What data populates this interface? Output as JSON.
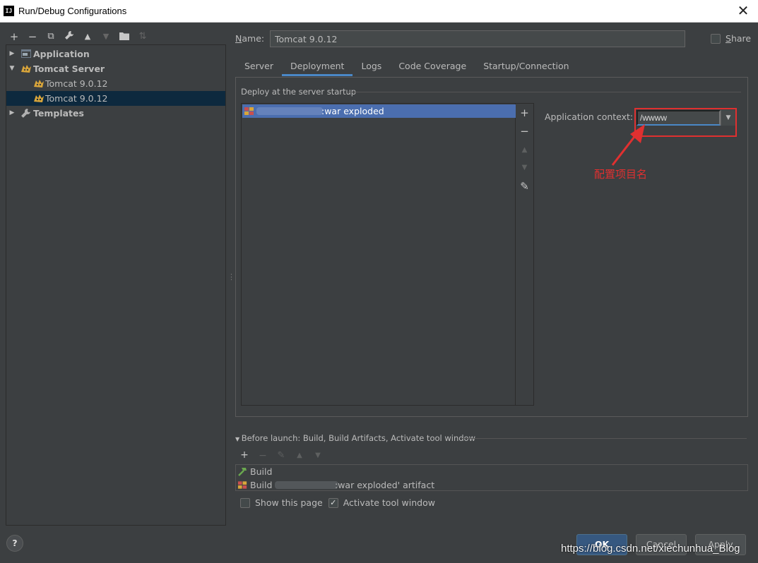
{
  "window": {
    "title": "Run/Debug Configurations",
    "app_icon": "IJ",
    "close_glyph": "✕"
  },
  "toolbar": {
    "items": [
      {
        "name": "add-icon",
        "glyph": "+"
      },
      {
        "name": "remove-icon",
        "glyph": "−"
      },
      {
        "name": "copy-icon",
        "glyph": "⧉"
      },
      {
        "name": "wrench-icon",
        "glyph": "🔧"
      },
      {
        "name": "move-up-icon",
        "glyph": "▲"
      },
      {
        "name": "move-down-icon",
        "glyph": "▼"
      },
      {
        "name": "folder-icon",
        "glyph": "▰"
      },
      {
        "name": "sort-icon",
        "glyph": "⇅"
      }
    ]
  },
  "tree": {
    "items": [
      {
        "label": "Application",
        "bold": true,
        "expanded": false,
        "icon": "application-icon"
      },
      {
        "label": "Tomcat Server",
        "bold": true,
        "expanded": true,
        "icon": "tomcat-icon"
      },
      {
        "label": "Tomcat 9.0.12",
        "bold": false,
        "icon": "tomcat-icon"
      },
      {
        "label": "Tomcat 9.0.12",
        "bold": false,
        "icon": "tomcat-icon",
        "selected": true
      },
      {
        "label": "Templates",
        "bold": true,
        "expanded": false,
        "icon": "wrench-icon"
      }
    ]
  },
  "help": "?",
  "name_field": {
    "label_prefix": "N",
    "label_rest": "ame:",
    "value": "Tomcat 9.0.12"
  },
  "share": {
    "label_prefix": "S",
    "label_rest": "hare",
    "checked": false
  },
  "tabs": [
    {
      "label": "Server",
      "active": false
    },
    {
      "label": "Deployment",
      "active": true
    },
    {
      "label": "Logs",
      "active": false
    },
    {
      "label": "Code Coverage",
      "active": false
    },
    {
      "label": "Startup/Connection",
      "active": false
    }
  ],
  "deployment": {
    "section_title": "Deploy at the server startup",
    "items": [
      {
        "text": ":war exploded",
        "selected": true
      }
    ],
    "side_tools": [
      "+",
      "−",
      "▲",
      "▼",
      "✎"
    ],
    "context_label": "Application context:",
    "context_value": "/wwww",
    "annotation": "配置项目名",
    "highlight_color": "#e03030"
  },
  "before_launch": {
    "title": "Before launch: Build, Build Artifacts, Activate tool window",
    "tools": [
      "+",
      "−",
      "✎",
      "▲",
      "▼"
    ],
    "items": [
      {
        "label": "Build",
        "icon": "hammer-icon"
      },
      {
        "label_prefix": "Build",
        "label_suffix": ":war exploded' artifact",
        "icon": "artifact-icon"
      }
    ]
  },
  "options": {
    "show_this_page": {
      "label": "Show this page",
      "checked": false
    },
    "activate_tool_window": {
      "label": "Activate tool window",
      "checked": true
    }
  },
  "buttons": {
    "ok": "OK",
    "cancel": "Cancel",
    "apply": "Apply"
  },
  "watermark": "https://blog.csdn.net/xiechunhua_Blog",
  "colors": {
    "background": "#3c3f41",
    "selection": "#0d293e",
    "list_selection": "#4b6eaf",
    "accent": "#4a88c7"
  }
}
